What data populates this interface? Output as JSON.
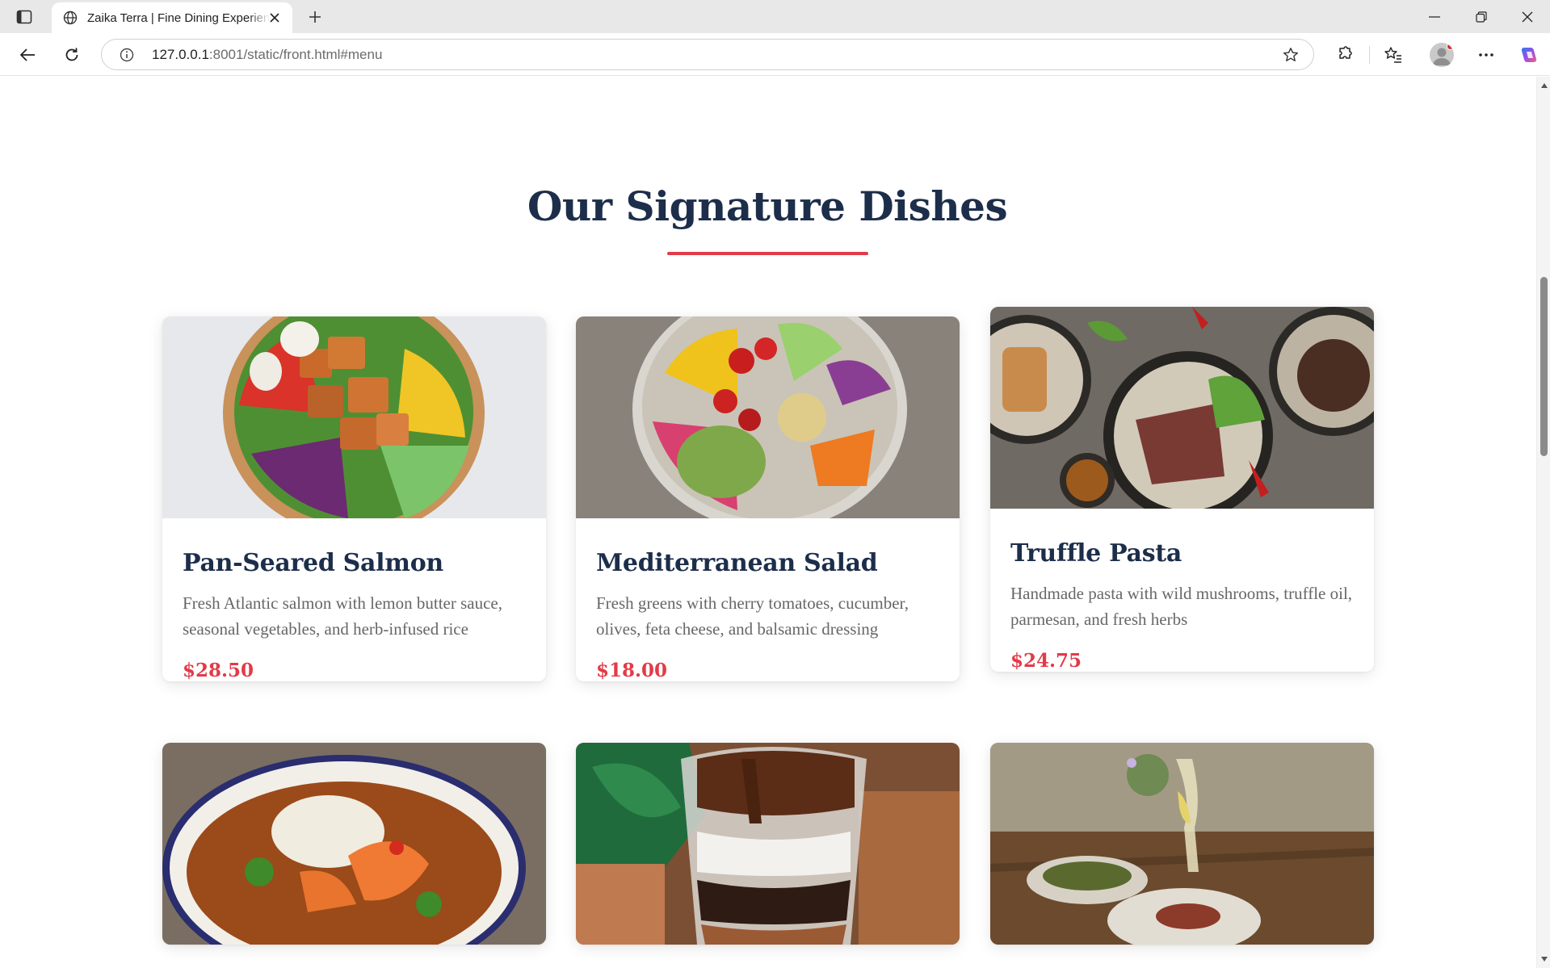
{
  "browser": {
    "tab_title": "Zaika Terra | Fine Dining Experience",
    "url_host": "127.0.0.1",
    "url_rest": ":8001/static/front.html#menu"
  },
  "menu": {
    "title": "Our Signature Dishes",
    "accent_color": "#e23b48",
    "heading_color": "#1c2e4a",
    "dishes": [
      {
        "name": "Pan-Seared Salmon",
        "description": "Fresh Atlantic salmon with lemon butter sauce, seasonal vegetables, and herb-infused rice",
        "price": "$28.50",
        "image": "salmon-bowl-photo"
      },
      {
        "name": "Mediterranean Salad",
        "description": "Fresh greens with cherry tomatoes, cucumber, olives, feta cheese, and balsamic dressing",
        "price": "$18.00",
        "image": "salad-bowl-photo"
      },
      {
        "name": "Truffle Pasta",
        "description": "Handmade pasta with wild mushrooms, truffle oil, parmesan, and fresh herbs",
        "price": "$24.75",
        "image": "plated-steak-photo"
      },
      {
        "image": "shrimp-curry-photo"
      },
      {
        "image": "chocolate-parfait-photo"
      },
      {
        "image": "wine-table-photo"
      }
    ]
  }
}
